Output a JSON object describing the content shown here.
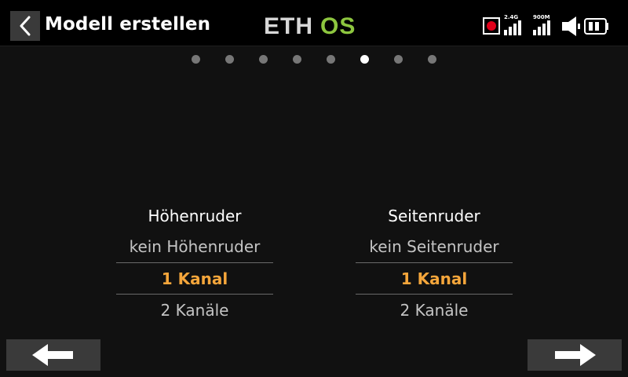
{
  "header": {
    "title": "Modell erstellen",
    "logo_left": "ETH",
    "logo_right": "OS",
    "logo_colors": {
      "left": "#d8d8d8",
      "right": "#8dc63f"
    },
    "icons": [
      "back-icon",
      "record-icon",
      "signal-2-4g-icon",
      "signal-900m-icon",
      "speaker-icon",
      "battery-icon"
    ],
    "signal_labels": [
      "2.4G",
      "900M"
    ],
    "record_color": "#e0001a"
  },
  "pager": {
    "count": 8,
    "active_index": 5
  },
  "columns": [
    {
      "title": "Höhenruder",
      "options": [
        "kein Höhenruder",
        "1 Kanal",
        "2 Kanäle"
      ],
      "selected": 1
    },
    {
      "title": "Seitenruder",
      "options": [
        "kein Seitenruder",
        "1 Kanal",
        "2 Kanäle"
      ],
      "selected": 1
    }
  ],
  "footer": {
    "prev_icon": "arrow-left-icon",
    "next_icon": "arrow-right-icon"
  },
  "colors": {
    "accent": "#f5a63b",
    "background": "#111111",
    "button": "#3a3a3a"
  }
}
